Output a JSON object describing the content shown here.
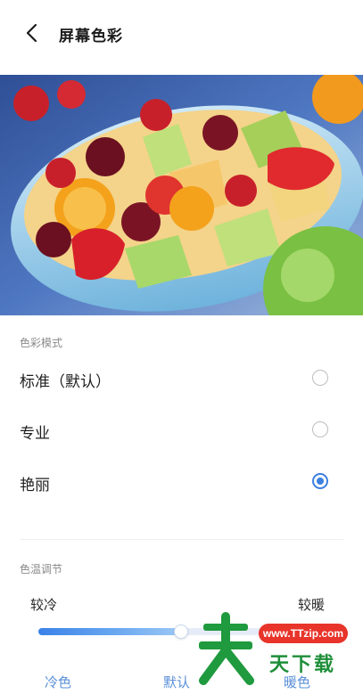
{
  "header": {
    "title": "屏幕色彩",
    "back_icon": "chevron-left-icon"
  },
  "preview": {
    "image_subject": "fruit salad bowl",
    "accent_colors": [
      "#d8202a",
      "#f4a21c",
      "#a6cf5a",
      "#7fc2e8",
      "#3a62a8"
    ]
  },
  "color_mode": {
    "label": "色彩模式",
    "options": [
      {
        "label": "标准（默认）",
        "selected": false
      },
      {
        "label": "专业",
        "selected": false
      },
      {
        "label": "艳丽",
        "selected": true
      }
    ]
  },
  "color_temp": {
    "label": "色温调节",
    "cooler_label": "较冷",
    "warmer_label": "较暖",
    "slider_value": 0.5,
    "presets": [
      "冷色",
      "默认",
      "暖色"
    ]
  },
  "watermark": {
    "url": "www.TTzip.com",
    "brand": "天下载"
  },
  "colors": {
    "accent": "#3b7fe0",
    "preset_text": "#5a8fd8",
    "watermark_green": "#1f8f3a",
    "watermark_red": "#e8342a"
  }
}
